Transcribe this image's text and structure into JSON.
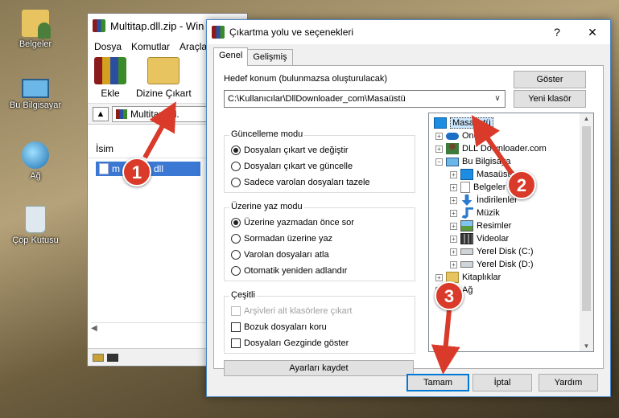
{
  "desktop": {
    "icons": [
      {
        "label": "Belgeler"
      },
      {
        "label": "Bu Bilgisayar"
      },
      {
        "label": "Ağ"
      },
      {
        "label": "Çöp Kutusu"
      }
    ]
  },
  "winrar": {
    "title": "Multitap.dll.zip - Win",
    "menu": [
      "Dosya",
      "Komutlar",
      "Araçla"
    ],
    "toolbar": {
      "add_label": "Ekle",
      "extract_label": "Dizine Çıkart"
    },
    "path": "Multitap.dll.",
    "column_name": "İsim",
    "file_item": "m",
    "file_item_suffix": "dll"
  },
  "dialog": {
    "title": "Çıkartma yolu ve seçenekleri",
    "help": "?",
    "close": "✕",
    "tabs": [
      "Genel",
      "Gelişmiş"
    ],
    "dest_label": "Hedef konum (bulunmazsa oluşturulacak)",
    "dest_value": "C:\\Kullanıcılar\\DllDownloader_com\\Masaüstü",
    "show_button": "Göster",
    "new_folder_button": "Yeni klasör",
    "update_mode": {
      "title": "Güncelleme modu",
      "options": [
        {
          "label": "Dosyaları çıkart ve değiştir",
          "selected": true
        },
        {
          "label": "Dosyaları çıkart ve güncelle",
          "selected": false
        },
        {
          "label": "Sadece varolan dosyaları tazele",
          "selected": false
        }
      ]
    },
    "overwrite_mode": {
      "title": "Üzerine yaz modu",
      "options": [
        {
          "label": "Üzerine yazmadan önce sor",
          "selected": true
        },
        {
          "label": "Sormadan üzerine yaz",
          "selected": false
        },
        {
          "label": "Varolan dosyaları atla",
          "selected": false
        },
        {
          "label": "Otomatik yeniden adlandır",
          "selected": false
        }
      ]
    },
    "misc": {
      "title": "Çeşitli",
      "options": [
        {
          "label": "Arşivleri alt klasörlere çıkart",
          "checked": false,
          "disabled": true
        },
        {
          "label": "Bozuk dosyaları koru",
          "checked": false,
          "disabled": false
        },
        {
          "label": "Dosyaları Gezginde göster",
          "checked": false,
          "disabled": false
        }
      ]
    },
    "save_button": "Ayarları kaydet",
    "tree": [
      {
        "label": "Masaüstü",
        "selected": true
      },
      {
        "label": "OneD"
      },
      {
        "label": "DLL Downloader.com"
      },
      {
        "label": "Bu Bilgisaya"
      },
      {
        "label": "Masaüstü"
      },
      {
        "label": "Belgeler"
      },
      {
        "label": "İndirilenler"
      },
      {
        "label": "Müzik"
      },
      {
        "label": "Resimler"
      },
      {
        "label": "Videolar"
      },
      {
        "label": "Yerel Disk (C:)"
      },
      {
        "label": "Yerel Disk (D:)"
      },
      {
        "label": "Kitaplıklar"
      },
      {
        "label": "Ağ"
      }
    ],
    "ok_button": "Tamam",
    "cancel_button": "İptal",
    "help_button": "Yardım"
  },
  "annotations": {
    "step1": "1",
    "step2": "2",
    "step3": "3",
    "color": "#d93a2a"
  }
}
